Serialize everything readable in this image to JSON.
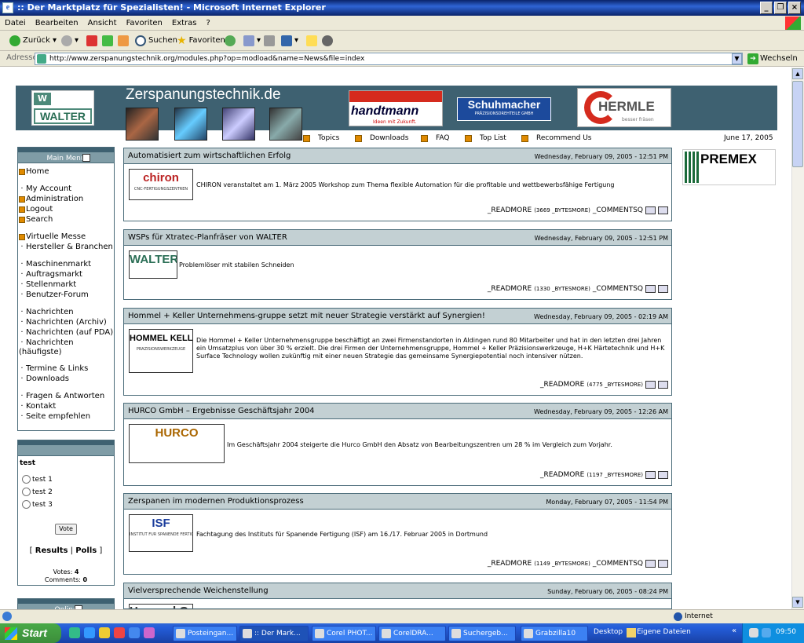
{
  "window": {
    "title": ":: Der Marktplatz für Spezialisten! - Microsoft Internet Explorer",
    "menu": [
      "Datei",
      "Bearbeiten",
      "Ansicht",
      "Favoriten",
      "Extras",
      "?"
    ],
    "toolbar": {
      "back": "Zurück",
      "search": "Suchen",
      "favorites": "Favoriten"
    },
    "address_label": "Adresse",
    "address": "http://www.zerspanungstechnik.org/modules.php?op=modload&name=News&file=index",
    "go": "Wechseln zu"
  },
  "site": {
    "title": "Zerspanungstechnik.de",
    "walter_logo": "WALTER",
    "handtmann": "handtmann",
    "handtmann_sub": "Ideen mit Zukunft.",
    "schuhmacher": "Schuhmacher",
    "schuhmacher_sub": "PRÄZISIONSDREHTEILE GMBH",
    "hermle": "HERMLE",
    "hermle_sub": "besser fräsen",
    "nav": [
      "Topics",
      "Downloads",
      "FAQ",
      "Top List",
      "Recommend Us"
    ],
    "date": "June 17, 2005",
    "premex": "PREMEX"
  },
  "main_menu": {
    "title": "Main Menu",
    "items": [
      {
        "label": "Home",
        "mark": "square"
      },
      {
        "label": "My Account",
        "mark": "dot"
      },
      {
        "label": "Administration",
        "mark": "square"
      },
      {
        "label": "Logout",
        "mark": "square"
      },
      {
        "label": "Search",
        "mark": "square"
      },
      {
        "label": "Virtuelle Messe",
        "mark": "square"
      },
      {
        "label": "Hersteller & Branchen",
        "mark": "dot"
      },
      {
        "label": "Maschinenmarkt",
        "mark": "dot"
      },
      {
        "label": "Auftragsmarkt",
        "mark": "dot"
      },
      {
        "label": "Stellenmarkt",
        "mark": "dot"
      },
      {
        "label": "Benutzer-Forum",
        "mark": "dot"
      },
      {
        "label": "Nachrichten",
        "mark": "dot"
      },
      {
        "label": "Nachrichten (Archiv)",
        "mark": "dot"
      },
      {
        "label": "Nachrichten (auf PDA)",
        "mark": "dot"
      },
      {
        "label": "Nachrichten",
        "mark": "dot"
      },
      {
        "label": "(häufigste)",
        "mark": "none"
      },
      {
        "label": "Termine & Links",
        "mark": "dot"
      },
      {
        "label": "Downloads",
        "mark": "dot"
      },
      {
        "label": "Fragen & Antworten",
        "mark": "dot"
      },
      {
        "label": "Kontakt",
        "mark": "dot"
      },
      {
        "label": "Seite empfehlen",
        "mark": "dot"
      }
    ]
  },
  "poll": {
    "question": "test",
    "options": [
      "test 1",
      "test 2",
      "test 3"
    ],
    "vote": "Vote",
    "results": "Results",
    "polls": "Polls",
    "votes_label": "Votes:",
    "votes": "4",
    "comments_label": "Comments:",
    "comments": "0"
  },
  "online": {
    "title": "Online"
  },
  "articles": [
    {
      "title": "Automatisiert zum wirtschaftlichen Erfolg",
      "date": "Wednesday, February 09, 2005 - 12:51 PM",
      "logo": "chiron",
      "logo_sub": "CNC-FERTIGUNGSZENTREN",
      "text": "CHIRON veranstaltet am 1. März 2005 Workshop zum Thema flexible Automation für die profitable und wettbewerbsfähige Fertigung",
      "readmore": "_READMORE",
      "bytes": "(3669 _BYTESMORE)",
      "comments": "_COMMENTSQ"
    },
    {
      "title": "WSPs für Xtratec-Planfräser von WALTER",
      "date": "Wednesday, February 09, 2005 - 12:51 PM",
      "logo": "WALTER",
      "logo_sub": "",
      "text": "Problemlöser mit stabilen Schneiden",
      "readmore": "_READMORE",
      "bytes": "(1330 _BYTESMORE)",
      "comments": "_COMMENTSQ"
    },
    {
      "title": "Hommel + Keller Unternehmens-gruppe setzt mit neuer Strategie verstärkt auf Synergien!",
      "date": "Wednesday, February 09, 2005 - 02:19 AM",
      "logo": "HOMMEL KELLER",
      "logo_sub": "PRÄZISIONSWERKZEUGE",
      "text": "Die Hommel + Keller Unternehmensgruppe beschäftigt an zwei Firmenstandorten in Aldingen rund 80 Mitarbeiter und hat in den letzten drei Jahren ein Umsatzplus von über 30 % erzielt. Die drei Firmen der Unternehmensgruppe, Hommel + Keller Präzisionswerkzeuge, H+K Härtetechnik und H+K Surface Technology wollen zukünftig mit einer neuen Strategie das gemeinsame Synergiepotential noch intensiver nützen.",
      "readmore": "_READMORE",
      "bytes": "(4775 _BYTESMORE)",
      "comments": ""
    },
    {
      "title": "HURCO GmbH – Ergebnisse Geschäftsjahr 2004",
      "date": "Wednesday, February 09, 2005 - 12:26 AM",
      "logo": "HURCO",
      "logo_sub": "",
      "text": "Im Geschäftsjahr 2004 steigerte die Hurco GmbH den Absatz von Bearbeitungszentren um 28 % im Vergleich zum Vorjahr.",
      "readmore": "_READMORE",
      "bytes": "(1197 _BYTESMORE)",
      "comments": ""
    },
    {
      "title": "Zerspanen im modernen Produktionsprozess",
      "date": "Monday, February 07, 2005 - 11:54 PM",
      "logo": "ISF",
      "logo_sub": "INSTITUT FÜR SPANENDE FERTIGUNG",
      "text": "Fachtagung des Instituts für Spanende Fertigung (ISF) am 16./17. Februar 2005 in Dortmund",
      "readmore": "_READMORE",
      "bytes": "(1149 _BYTESMORE)",
      "comments": "_COMMENTSQ"
    },
    {
      "title": "Vielversprechende Weichenstellung",
      "date": "Sunday, February 06, 2005 - 08:24 PM",
      "logo": "Hommel Gruppe",
      "logo_sub": "",
      "text": "",
      "readmore": "",
      "bytes": "",
      "comments": ""
    }
  ],
  "status": {
    "zone": "Internet"
  },
  "taskbar": {
    "start": "Start",
    "tasks": [
      "Posteingan...",
      ":: Der Mark...",
      "Corel PHOT...",
      "CorelDRA...",
      "Suchergeb...",
      "Grabzilla10"
    ],
    "desktop": "Desktop",
    "eigene": "Eigene Dateien",
    "clock": "09:50"
  }
}
